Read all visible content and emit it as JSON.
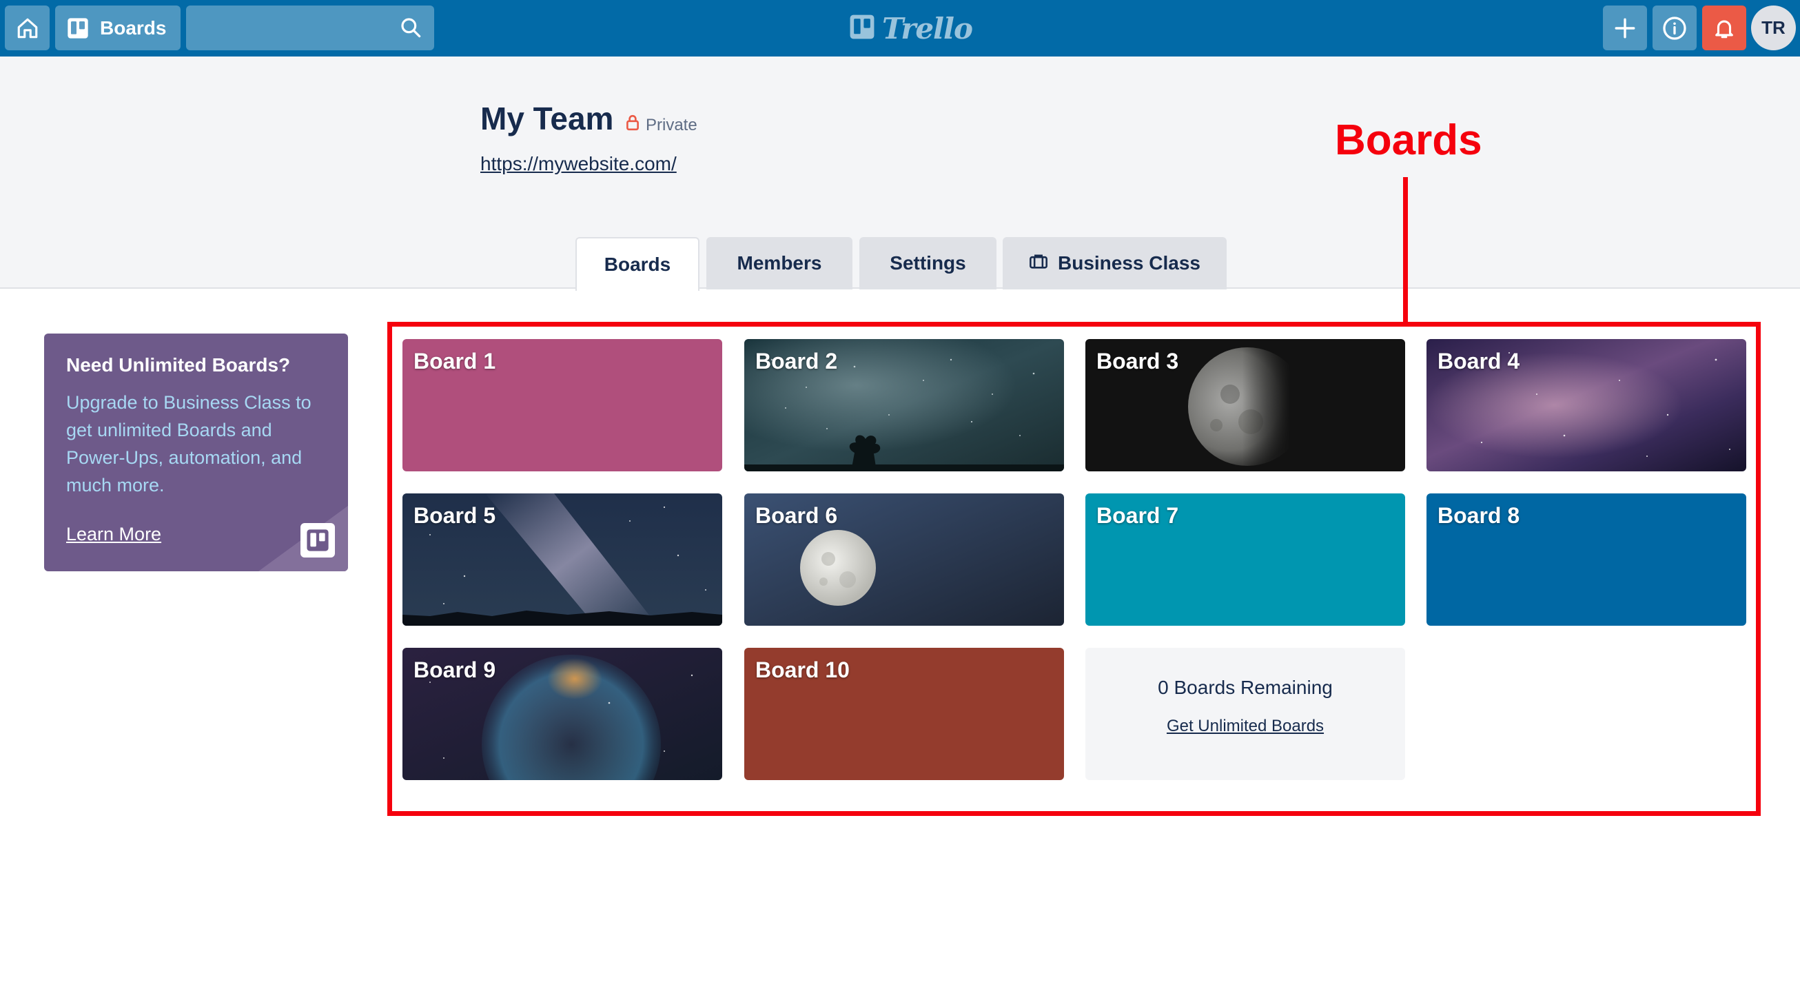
{
  "topbar": {
    "boards_label": "Boards",
    "search_value": "",
    "logo_text": "Trello",
    "avatar_initials": "TR",
    "icons": [
      "home-icon",
      "boards-icon",
      "search-icon",
      "trello-logo-icon",
      "plus-icon",
      "info-icon",
      "bell-icon"
    ],
    "bar_color": "#026aa7",
    "notification_color": "#eb5a46"
  },
  "team": {
    "name": "My Team",
    "privacy": "Private",
    "url": "https://mywebsite.com/"
  },
  "tabs": [
    {
      "label": "Boards",
      "active": true
    },
    {
      "label": "Members",
      "active": false
    },
    {
      "label": "Settings",
      "active": false
    },
    {
      "label": "Business Class",
      "active": false
    }
  ],
  "promo": {
    "title": "Need Unlimited Boards?",
    "body": "Upgrade to Business Class to get unlimited Boards and Power-Ups, automation, and much more.",
    "link": "Learn More",
    "color": "#6e5a8a"
  },
  "boards": [
    {
      "title": "Board 1",
      "background": "#b04f7c"
    },
    {
      "title": "Board 2",
      "background": "starry-sky-tree-photo"
    },
    {
      "title": "Board 3",
      "background": "partial-moon-photo"
    },
    {
      "title": "Board 4",
      "background": "nebula-photo"
    },
    {
      "title": "Board 5",
      "background": "milky-way-photo"
    },
    {
      "title": "Board 6",
      "background": "full-moon-photo"
    },
    {
      "title": "Board 7",
      "background": "#0096b0"
    },
    {
      "title": "Board 8",
      "background": "#0067a3"
    },
    {
      "title": "Board 9",
      "background": "bubble-nebula-photo"
    },
    {
      "title": "Board 10",
      "background": "#943c2d"
    }
  ],
  "remaining": {
    "count_text": "0 Boards Remaining",
    "cta": "Get Unlimited Boards"
  },
  "annotation": {
    "label": "Boards",
    "color": "#f5010d"
  }
}
